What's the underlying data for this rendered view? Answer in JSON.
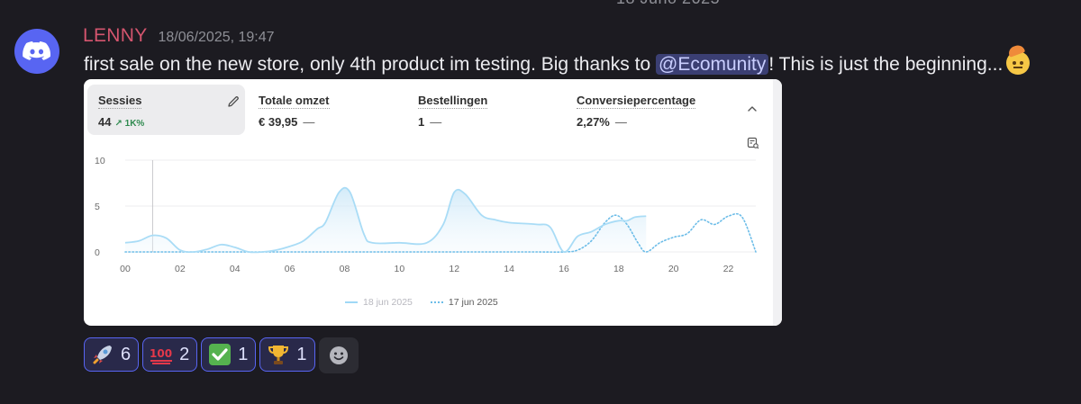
{
  "top_clip_text": "18 Juno 2025",
  "message": {
    "username": "LENNY",
    "timestamp": "18/06/2025, 19:47",
    "text_before": "first sale on the new store, only 4th product im testing. Big thanks to ",
    "mention": "@Ecomunity",
    "text_after": "! This is just the beginning..."
  },
  "card": {
    "metrics": [
      {
        "label": "Sessies",
        "value": "44",
        "change": "↗ 1K%",
        "active": true
      },
      {
        "label": "Totale omzet",
        "value": "€ 39,95",
        "dash": "—"
      },
      {
        "label": "Bestellingen",
        "value": "1",
        "dash": "—"
      },
      {
        "label": "Conversiepercentage",
        "value": "2,27%",
        "dash": "—"
      }
    ],
    "legend": {
      "current": "18 jun 2025",
      "previous": "17 jun 2025"
    }
  },
  "chart_data": {
    "type": "line",
    "x_ticks": [
      "00",
      "02",
      "04",
      "06",
      "08",
      "10",
      "12",
      "14",
      "16",
      "18",
      "20",
      "22"
    ],
    "y_ticks": [
      "0",
      "5",
      "10"
    ],
    "ylim": [
      0,
      10
    ],
    "xlim": [
      0,
      23
    ],
    "series": [
      {
        "name": "18 jun 2025",
        "style": "solid",
        "color": "#a9dcf6",
        "points": [
          [
            0,
            1
          ],
          [
            0.5,
            1.2
          ],
          [
            1,
            1.8
          ],
          [
            1.5,
            1.5
          ],
          [
            2,
            0.2
          ],
          [
            2.5,
            0
          ],
          [
            3,
            0.3
          ],
          [
            3.5,
            0.8
          ],
          [
            4,
            0.5
          ],
          [
            4.5,
            0
          ],
          [
            5,
            0
          ],
          [
            5.5,
            0.2
          ],
          [
            6,
            0.6
          ],
          [
            6.5,
            1.2
          ],
          [
            7,
            2.5
          ],
          [
            7.3,
            3.2
          ],
          [
            7.8,
            6.5
          ],
          [
            8.2,
            6.5
          ],
          [
            8.7,
            2
          ],
          [
            9,
            1
          ],
          [
            10,
            1
          ],
          [
            11,
            1
          ],
          [
            11.6,
            3
          ],
          [
            12,
            6.5
          ],
          [
            12.4,
            6.3
          ],
          [
            13,
            4
          ],
          [
            13.5,
            3.5
          ],
          [
            14,
            3.2
          ],
          [
            15,
            3
          ],
          [
            15.5,
            2.7
          ],
          [
            16,
            0
          ],
          [
            16.5,
            1.7
          ],
          [
            17,
            2.2
          ],
          [
            17.5,
            3
          ],
          [
            18,
            3.4
          ],
          [
            18.3,
            3.4
          ],
          [
            18.6,
            3.8
          ],
          [
            19,
            3.9
          ]
        ]
      },
      {
        "name": "17 jun 2025",
        "style": "dotted",
        "color": "#6dbde8",
        "points": [
          [
            0,
            0
          ],
          [
            1,
            0
          ],
          [
            2,
            0
          ],
          [
            3,
            0
          ],
          [
            4,
            0
          ],
          [
            5,
            0
          ],
          [
            6,
            0
          ],
          [
            7,
            0
          ],
          [
            8,
            0
          ],
          [
            9,
            0
          ],
          [
            10,
            0
          ],
          [
            11,
            0
          ],
          [
            12,
            0
          ],
          [
            13,
            0
          ],
          [
            14,
            0
          ],
          [
            15,
            0
          ],
          [
            16,
            0
          ],
          [
            16.5,
            0.2
          ],
          [
            17,
            1.2
          ],
          [
            17.5,
            3.2
          ],
          [
            17.9,
            4
          ],
          [
            18.3,
            3
          ],
          [
            18.7,
            1
          ],
          [
            19,
            0
          ],
          [
            19.5,
            1
          ],
          [
            20,
            1.6
          ],
          [
            20.5,
            2
          ],
          [
            21,
            3.5
          ],
          [
            21.5,
            3
          ],
          [
            22,
            3.9
          ],
          [
            22.5,
            3.8
          ],
          [
            23,
            0
          ]
        ]
      }
    ]
  },
  "reactions": [
    {
      "emoji": "rocket",
      "count": "6"
    },
    {
      "emoji": "hundred",
      "count": "2"
    },
    {
      "emoji": "check",
      "count": "1"
    },
    {
      "emoji": "trophy",
      "count": "1"
    }
  ]
}
